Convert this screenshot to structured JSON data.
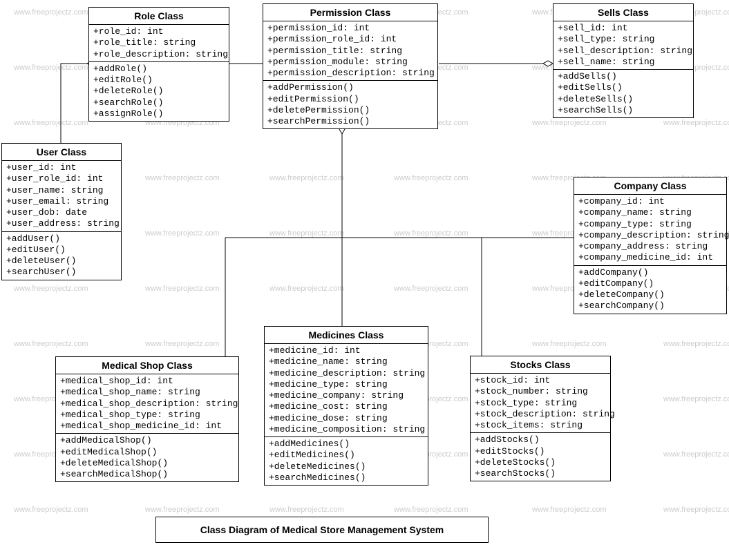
{
  "watermark": "www.freeprojectz.com",
  "title": "Class Diagram of Medical Store Management System",
  "classes": {
    "role": {
      "name": "Role Class",
      "attrs": [
        "+role_id: int",
        "+role_title: string",
        "+role_description: string"
      ],
      "methods": [
        "+addRole()",
        "+editRole()",
        "+deleteRole()",
        "+searchRole()",
        "+assignRole()"
      ]
    },
    "permission": {
      "name": "Permission Class",
      "attrs": [
        "+permission_id: int",
        "+permission_role_id: int",
        "+permission_title: string",
        "+permission_module: string",
        "+permission_description: string"
      ],
      "methods": [
        "+addPermission()",
        "+editPermission()",
        "+deletePermission()",
        "+searchPermission()"
      ]
    },
    "sells": {
      "name": "Sells Class",
      "attrs": [
        "+sell_id: int",
        "+sell_type: string",
        "+sell_description: string",
        "+sell_name: string"
      ],
      "methods": [
        "+addSells()",
        "+editSells()",
        "+deleteSells()",
        "+searchSells()"
      ]
    },
    "user": {
      "name": "User Class",
      "attrs": [
        "+user_id: int",
        "+user_role_id: int",
        "+user_name: string",
        "+user_email: string",
        "+user_dob: date",
        "+user_address: string"
      ],
      "methods": [
        "+addUser()",
        "+editUser()",
        "+deleteUser()",
        "+searchUser()"
      ]
    },
    "company": {
      "name": "Company Class",
      "attrs": [
        "+company_id: int",
        "+company_name: string",
        "+company_type: string",
        "+company_description: string",
        "+company_address: string",
        "+company_medicine_id: int"
      ],
      "methods": [
        "+addCompany()",
        "+editCompany()",
        "+deleteCompany()",
        "+searchCompany()"
      ]
    },
    "medicalshop": {
      "name": "Medical Shop Class",
      "attrs": [
        "+medical_shop_id: int",
        "+medical_shop_name: string",
        "+medical_shop_description: string",
        "+medical_shop_type: string",
        "+medical_shop_medicine_id: int"
      ],
      "methods": [
        "+addMedicalShop()",
        "+editMedicalShop()",
        "+deleteMedicalShop()",
        "+searchMedicalShop()"
      ]
    },
    "medicines": {
      "name": "Medicines  Class",
      "attrs": [
        "+medicine_id: int",
        "+medicine_name: string",
        "+medicine_description: string",
        "+medicine_type: string",
        "+medicine_company: string",
        "+medicine_cost: string",
        "+medicine_dose: string",
        "+medicine_composition: string"
      ],
      "methods": [
        "+addMedicines()",
        "+editMedicines()",
        "+deleteMedicines()",
        "+searchMedicines()"
      ]
    },
    "stocks": {
      "name": "Stocks Class",
      "attrs": [
        "+stock_id: int",
        "+stock_number: string",
        "+stock_type: string",
        "+stock_description: string",
        "+stock_items: string"
      ],
      "methods": [
        "+addStocks()",
        "+editStocks()",
        "+deleteStocks()",
        "+searchStocks()"
      ]
    }
  }
}
